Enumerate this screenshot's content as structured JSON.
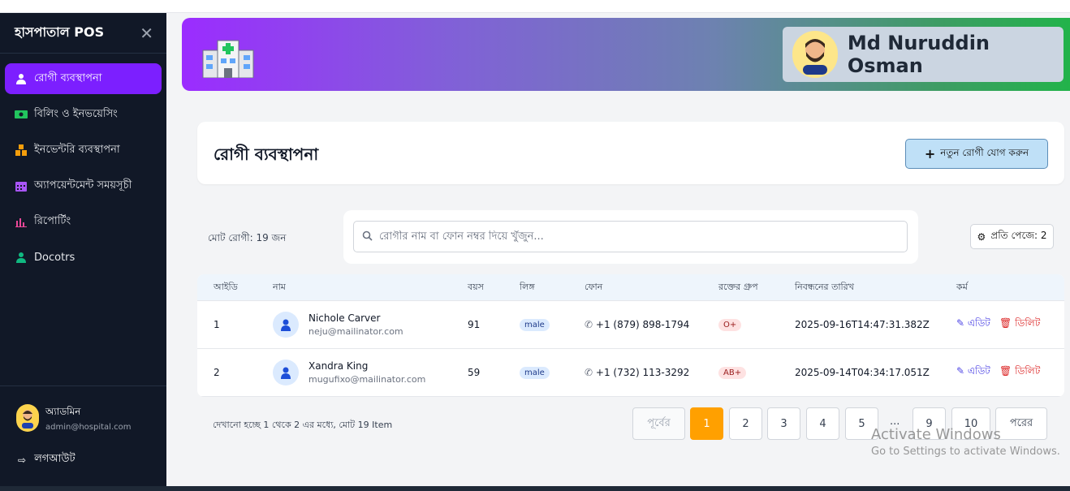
{
  "sidebar": {
    "brand": "হাসপাতাল POS",
    "items": [
      {
        "label": "রোগী ব্যবস্থাপনা",
        "icon": "user-doctor-icon",
        "active": true
      },
      {
        "label": "বিলিং ও ইনভয়েসিং",
        "icon": "money-bill-icon"
      },
      {
        "label": "ইনভেন্টরি ব্যবস্থাপনা",
        "icon": "boxes-icon"
      },
      {
        "label": "অ্যাপয়েন্টমেন্ট সময়সূচী",
        "icon": "calendar-icon"
      },
      {
        "label": "রিপোর্টিং",
        "icon": "chart-icon"
      },
      {
        "label": "Docotrs",
        "icon": "user-icon"
      }
    ],
    "admin_name": "অ্যাডমিন",
    "admin_email": "admin@hospital.com",
    "logout": "লগআউট"
  },
  "header": {
    "user_name": "Md Nuruddin Osman"
  },
  "page": {
    "title": "রোগী ব্যবস্থাপনা",
    "add_button": "নতুন রোগী যোগ করুন",
    "total": "মোট রোগী: 19 জন",
    "search_placeholder": "রোগীর নাম বা ফোন নম্বর দিয়ে খুঁজুন...",
    "per_page": "প্রতি পেজে: 2"
  },
  "table": {
    "columns": [
      "আইডি",
      "নাম",
      "বয়স",
      "লিঙ্গ",
      "ফোন",
      "রক্তের গ্রুপ",
      "নিবন্ধনের তারিখ",
      "কর্ম"
    ],
    "rows": [
      {
        "id": "1",
        "name": "Nichole Carver",
        "email": "neju@mailinator.com",
        "age": "91",
        "gender": "male",
        "phone": "+1 (879) 898-1794",
        "blood": "O+",
        "date": "2025-09-16T14:47:31.382Z",
        "edit": "এডিট",
        "delete": "ডিলিট"
      },
      {
        "id": "2",
        "name": "Xandra King",
        "email": "mugufixo@mailinator.com",
        "age": "59",
        "gender": "male",
        "phone": "+1 (732) 113-3292",
        "blood": "AB+",
        "date": "2025-09-14T04:34:17.051Z",
        "edit": "এডিট",
        "delete": "ডিলিট"
      }
    ]
  },
  "pagination": {
    "showing": "দেখানো হচ্ছে 1 থেকে 2 এর মধ্যে, মোট 19 Item",
    "prev": "পূর্বের",
    "pages": [
      "1",
      "2",
      "3",
      "4",
      "5"
    ],
    "dots": "...",
    "tail_pages": [
      "9",
      "10"
    ],
    "next": "পরের",
    "current": "1"
  },
  "watermark": {
    "line1": "Activate Windows",
    "line2": "Go to Settings to activate Windows."
  },
  "colors": {
    "accent": "#7c1fff",
    "active_page": "#ffa000",
    "sidebar_bg": "#111827"
  }
}
